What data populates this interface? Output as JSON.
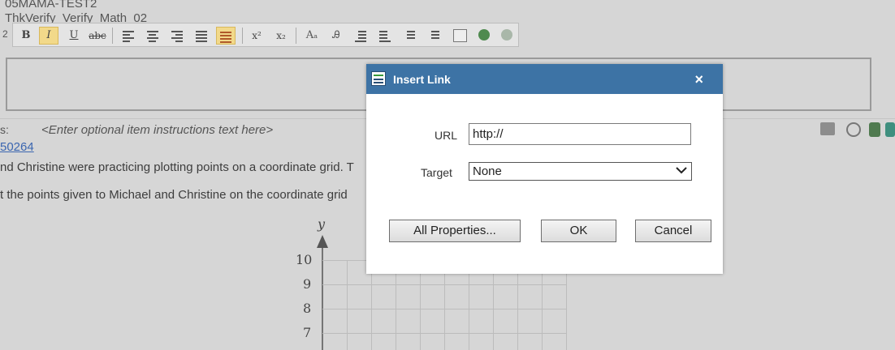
{
  "header": {
    "line1": "05MAMA-TEST2",
    "line2": "ThkVerify_Verify_Math_02",
    "line3_prefix": "2"
  },
  "toolbar": {
    "bold": "B",
    "italic": "I",
    "underline": "U",
    "strike": "abc",
    "superscript": "x²",
    "subscript": "x₂"
  },
  "instructions": {
    "label": "s:",
    "placeholder": "<Enter optional item instructions text here>"
  },
  "item_link": "50264",
  "paragraphs": {
    "p1": "nd Christine were practicing plotting points on a coordinate grid. T",
    "p2": "t the points given to Michael and Christine on the coordinate grid"
  },
  "graph": {
    "y_axis_label": "y",
    "y_ticks": [
      "10",
      "9",
      "8",
      "7"
    ]
  },
  "dialog": {
    "title": "Insert Link",
    "close": "×",
    "url_label": "URL",
    "url_value": "http://",
    "target_label": "Target",
    "target_value": "None",
    "all_properties": "All Properties...",
    "ok": "OK",
    "cancel": "Cancel"
  }
}
